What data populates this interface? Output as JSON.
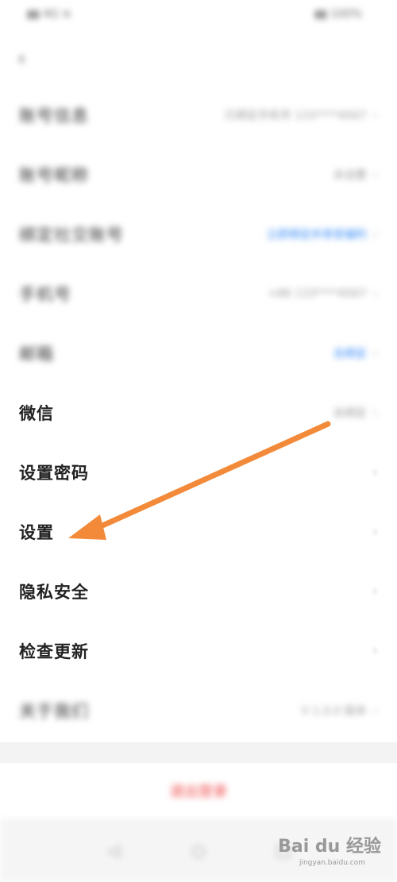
{
  "status_bar": {
    "left": "▮▮ 4G ≋",
    "right": "▮▮ 100%"
  },
  "back": {
    "icon": "chevron-left-icon",
    "glyph": "‹"
  },
  "rows": [
    {
      "label": "账号信息",
      "value": "已绑定手机号 133****4567",
      "value_style": "normal",
      "blur": true
    },
    {
      "label": "账号昵称",
      "value": "未设置",
      "value_style": "normal",
      "blur": true
    },
    {
      "label": "绑定社交账号",
      "value": "立即绑定并享受福利",
      "value_style": "blue",
      "blur": true
    },
    {
      "label": "手机号",
      "value": "+86 133****4567",
      "value_style": "normal",
      "blur": true
    },
    {
      "label": "邮箱",
      "value": "去绑定",
      "value_style": "blue",
      "blur": true
    },
    {
      "label": "微信",
      "value": "未绑定",
      "value_style": "normal",
      "blur": false
    },
    {
      "label": "设置密码",
      "value": "",
      "value_style": "normal",
      "blur": false
    },
    {
      "label": "设置",
      "value": "",
      "value_style": "normal",
      "blur": false
    },
    {
      "label": "隐私安全",
      "value": "",
      "value_style": "normal",
      "blur": false
    },
    {
      "label": "检查更新",
      "value": "",
      "value_style": "normal",
      "blur": false
    },
    {
      "label": "关于我们",
      "value": "V 1.0.0 版本",
      "value_style": "normal",
      "blur": true
    }
  ],
  "chevron": "›",
  "logout": {
    "label": "退出登录"
  },
  "bottom_nav": [
    {
      "name": "nav-back-button",
      "glyph": "◁"
    },
    {
      "name": "nav-home-button",
      "glyph": "○"
    },
    {
      "name": "nav-recents-button",
      "glyph": "□"
    }
  ],
  "colors": {
    "arrow": "#f28a3a",
    "link": "#2f86f6",
    "danger": "#f04848"
  },
  "watermark": {
    "text": "Bai du 经验",
    "url": "jingyan.baidu.com"
  }
}
